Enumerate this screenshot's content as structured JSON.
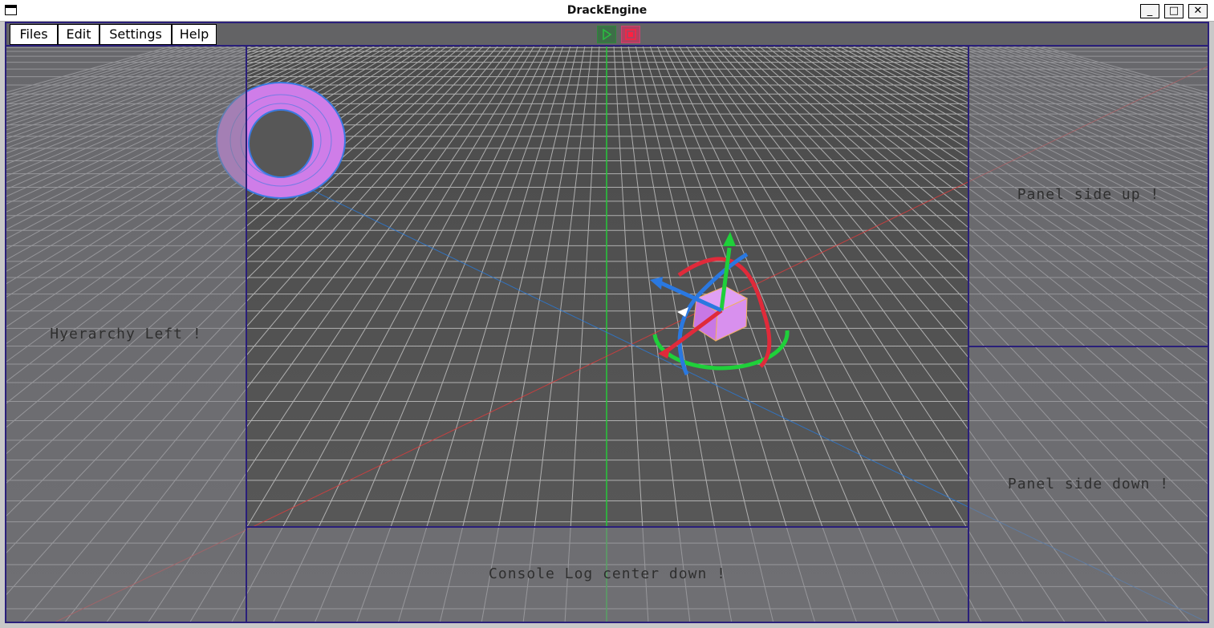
{
  "window": {
    "title": "DrackEngine",
    "controls": {
      "minimize": "_",
      "maximize": "□",
      "close": "✕"
    }
  },
  "menubar": {
    "items": [
      {
        "label": "Files"
      },
      {
        "label": "Edit"
      },
      {
        "label": "Settings"
      },
      {
        "label": "Help"
      }
    ],
    "play_icon": "play-icon",
    "stop_icon": "stop-icon"
  },
  "panels": {
    "hierarchy": "Hyerarchy Left !",
    "console": "Console Log center down !",
    "side_up": "Panel side up !",
    "side_down": "Panel side down !"
  },
  "colors": {
    "panel_border": "#2a1f7a",
    "grid": "#d0d0d0",
    "axis_x": "#e03b3b",
    "axis_y": "#1fc83a",
    "axis_z": "#2a7ad8",
    "mesh": "#d58cf0"
  }
}
